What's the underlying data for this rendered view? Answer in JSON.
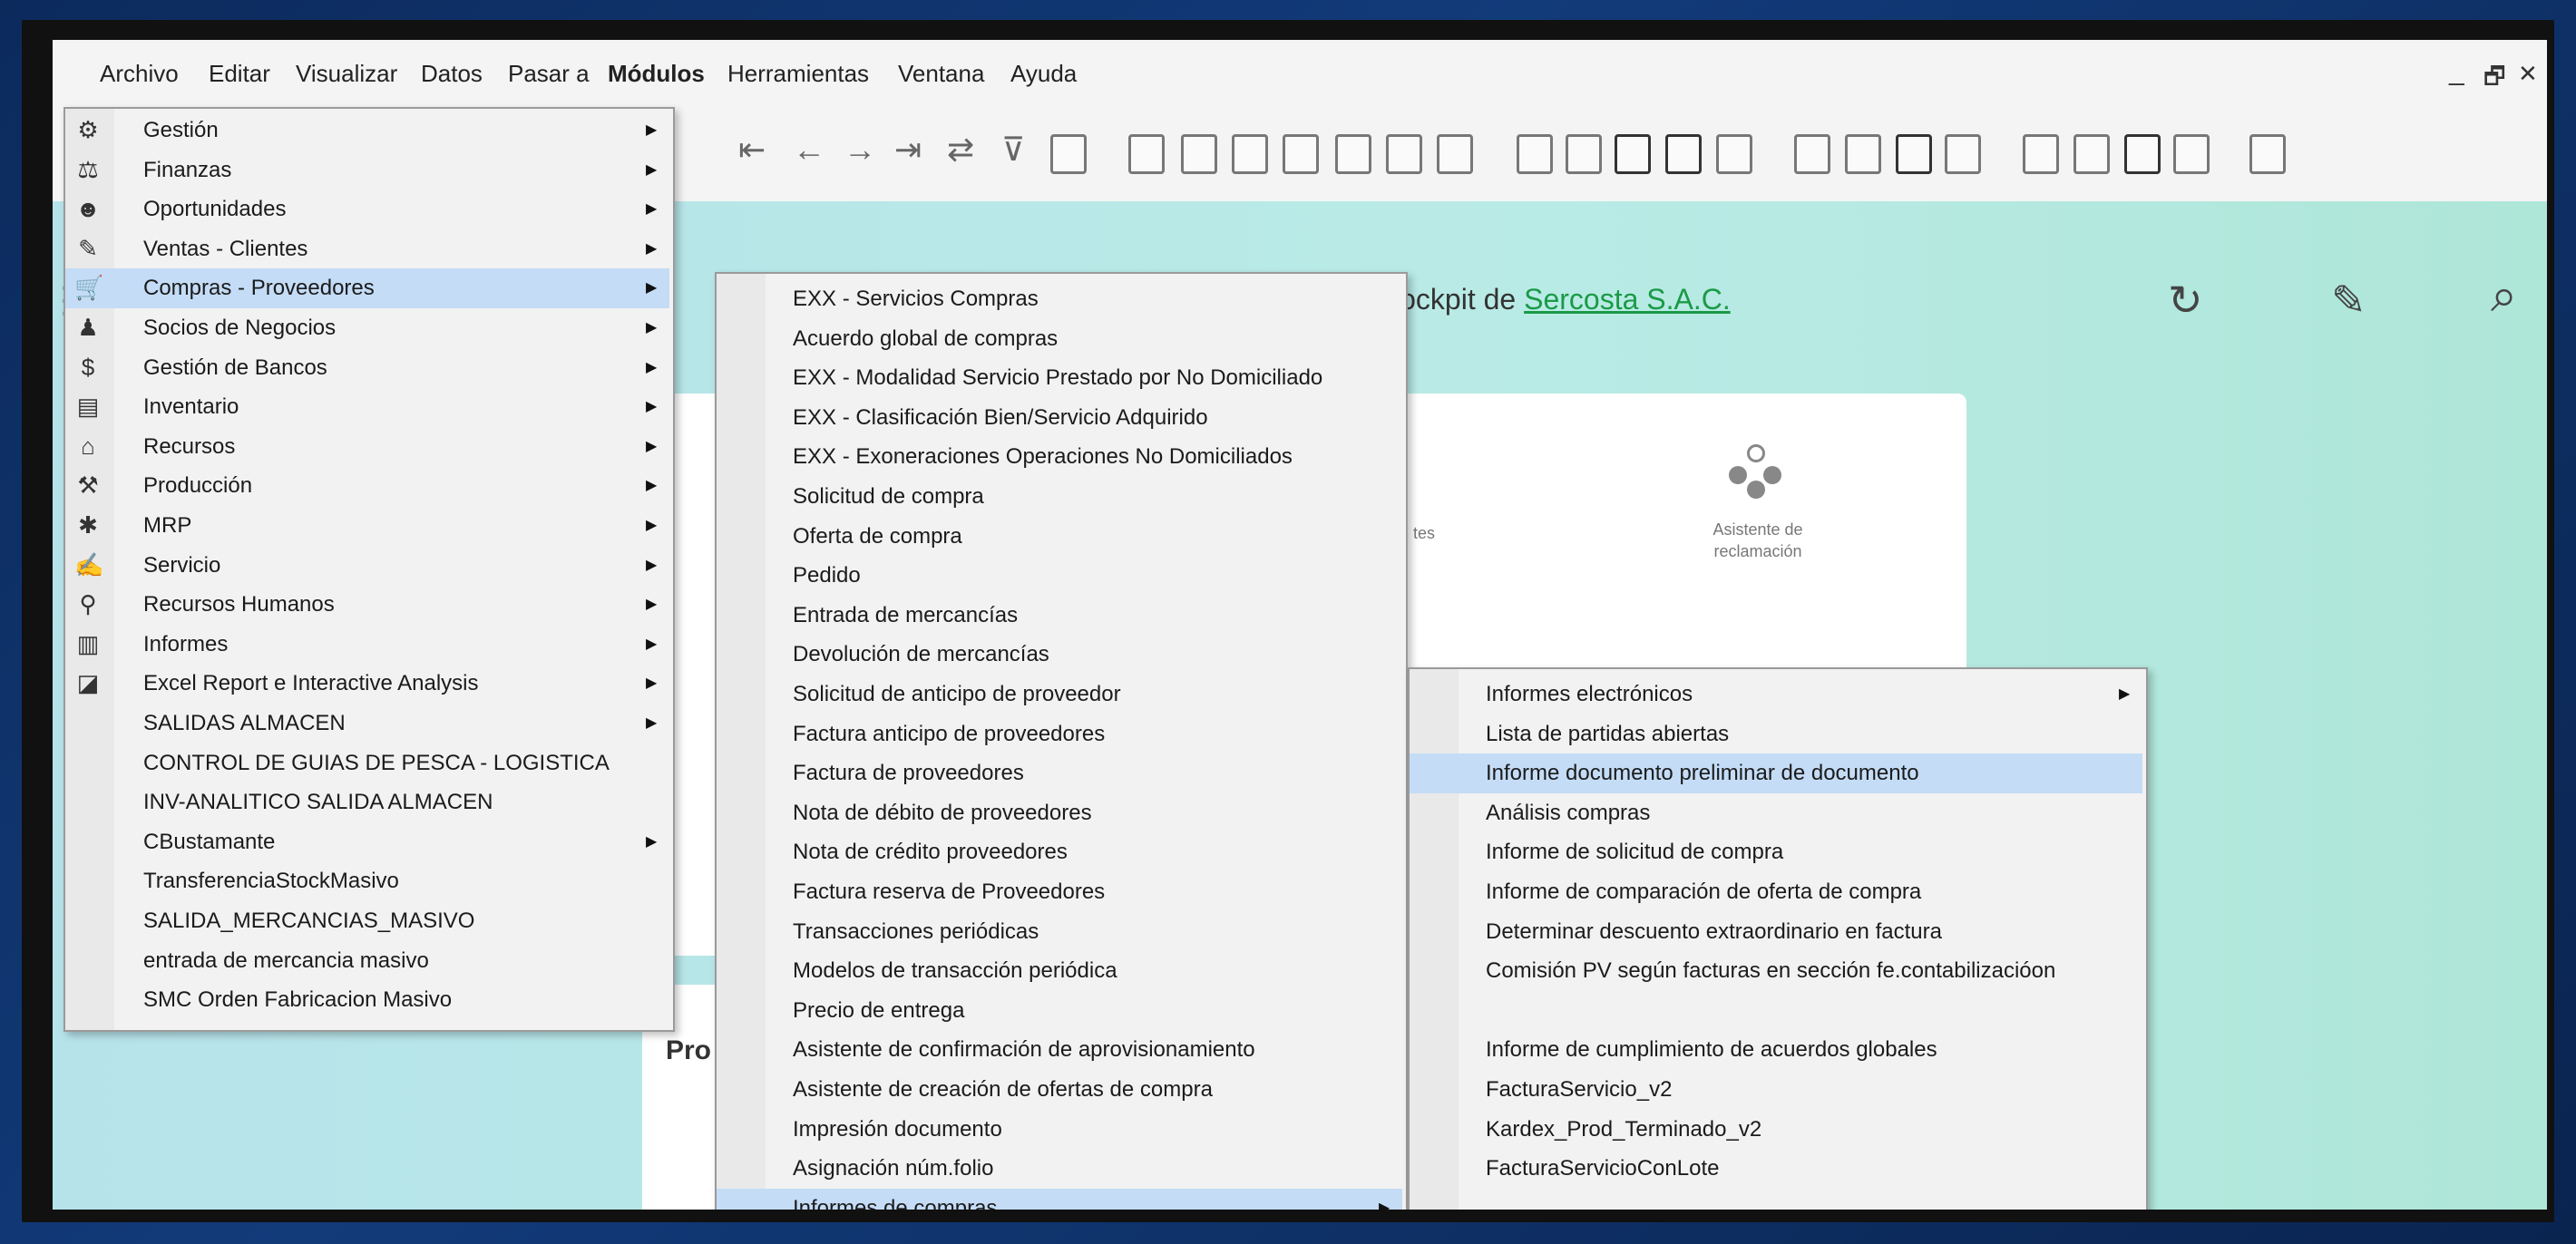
{
  "menubar": {
    "items": [
      "Archivo",
      "Editar",
      "Visualizar",
      "Datos",
      "Pasar a",
      "Módulos",
      "Herramientas",
      "Ventana",
      "Ayuda"
    ],
    "window_controls": [
      "_",
      "🗗",
      "✕"
    ]
  },
  "cockpit": {
    "welcome_prefix": "Bienvenido, manager. Se conectó a cockpit de ",
    "company": "Sercosta S.A.C.",
    "truncated_tes": "tes",
    "assistant_label": "Asistente de reclamación",
    "pro_label": "Pro",
    "refresh_icon": "↻",
    "edit_icon": "✎",
    "search_icon": "⌕",
    "hamburger_icon": "☰"
  },
  "modules_menu": {
    "items": [
      {
        "label": "Gestión",
        "icon": "⚙",
        "submenu": true
      },
      {
        "label": "Finanzas",
        "icon": "⚖",
        "submenu": true
      },
      {
        "label": "Oportunidades",
        "icon": "☻",
        "submenu": true
      },
      {
        "label": "Ventas - Clientes",
        "icon": "✎",
        "submenu": true
      },
      {
        "label": "Compras - Proveedores",
        "icon": "🛒",
        "submenu": true
      },
      {
        "label": "Socios de Negocios",
        "icon": "♟",
        "submenu": true
      },
      {
        "label": "Gestión de Bancos",
        "icon": "$",
        "submenu": true
      },
      {
        "label": "Inventario",
        "icon": "▤",
        "submenu": true
      },
      {
        "label": "Recursos",
        "icon": "⌂",
        "submenu": true
      },
      {
        "label": "Producción",
        "icon": "⚒",
        "submenu": true
      },
      {
        "label": "MRP",
        "icon": "✱",
        "submenu": true
      },
      {
        "label": "Servicio",
        "icon": "✍",
        "submenu": true
      },
      {
        "label": "Recursos Humanos",
        "icon": "⚲",
        "submenu": true
      },
      {
        "label": "Informes",
        "icon": "▥",
        "submenu": true
      },
      {
        "label": "Excel Report e Interactive Analysis",
        "icon": "◪",
        "submenu": true
      },
      {
        "label": "SALIDAS ALMACEN",
        "icon": "",
        "submenu": true
      },
      {
        "label": "CONTROL DE GUIAS DE PESCA  -  LOGISTICA",
        "icon": "",
        "submenu": false
      },
      {
        "label": "INV-ANALITICO SALIDA ALMACEN",
        "icon": "",
        "submenu": false
      },
      {
        "label": "CBustamante",
        "icon": "",
        "submenu": true
      },
      {
        "label": "TransferenciaStockMasivo",
        "icon": "",
        "submenu": false
      },
      {
        "label": "SALIDA_MERCANCIAS_MASIVO",
        "icon": "",
        "submenu": false
      },
      {
        "label": "entrada de mercancia masivo",
        "icon": "",
        "submenu": false
      },
      {
        "label": "SMC Orden Fabricacion Masivo",
        "icon": "",
        "submenu": false
      }
    ]
  },
  "compras_menu": {
    "items": [
      {
        "label": "EXX - Servicios Compras",
        "submenu": false
      },
      {
        "label": "Acuerdo global de compras",
        "submenu": false
      },
      {
        "label": "EXX - Modalidad Servicio Prestado por No Domiciliado",
        "submenu": false
      },
      {
        "label": "EXX - Clasificación Bien/Servicio Adquirido",
        "submenu": false
      },
      {
        "label": "EXX - Exoneraciones Operaciones No Domiciliados",
        "submenu": false
      },
      {
        "label": "Solicitud de compra",
        "submenu": false
      },
      {
        "label": "Oferta de compra",
        "submenu": false
      },
      {
        "label": "Pedido",
        "submenu": false
      },
      {
        "label": "Entrada de mercancías",
        "submenu": false
      },
      {
        "label": "Devolución de mercancías",
        "submenu": false
      },
      {
        "label": "Solicitud de anticipo de proveedor",
        "submenu": false
      },
      {
        "label": "Factura anticipo de proveedores",
        "submenu": false
      },
      {
        "label": "Factura de proveedores",
        "submenu": false
      },
      {
        "label": "Nota de débito de proveedores",
        "submenu": false
      },
      {
        "label": "Nota de crédito proveedores",
        "submenu": false
      },
      {
        "label": "Factura reserva de Proveedores",
        "submenu": false
      },
      {
        "label": "Transacciones periódicas",
        "submenu": false
      },
      {
        "label": "Modelos de transacción periódica",
        "submenu": false
      },
      {
        "label": "Precio de entrega",
        "submenu": false
      },
      {
        "label": "Asistente de confirmación de aprovisionamiento",
        "submenu": false
      },
      {
        "label": "Asistente de creación de ofertas de compra",
        "submenu": false
      },
      {
        "label": "Impresión documento",
        "submenu": false
      },
      {
        "label": "Asignación núm.folio",
        "submenu": false
      },
      {
        "label": "Informes de compras",
        "submenu": true
      }
    ]
  },
  "informes_menu": {
    "items": [
      {
        "label": "Informes electrónicos",
        "submenu": true
      },
      {
        "label": "Lista de partidas abiertas",
        "submenu": false
      },
      {
        "label": "Informe documento preliminar de documento",
        "submenu": false
      },
      {
        "label": "Análisis compras",
        "submenu": false
      },
      {
        "label": "Informe de solicitud de compra",
        "submenu": false
      },
      {
        "label": "Informe de comparación de oferta de compra",
        "submenu": false
      },
      {
        "label": "Determinar descuento extraordinario en factura",
        "submenu": false
      },
      {
        "label": "Comisión PV según facturas en sección fe.contabilizacióon",
        "submenu": false
      },
      {
        "label": "",
        "submenu": false
      },
      {
        "label": "Informe de cumplimiento de acuerdos globales",
        "submenu": false
      },
      {
        "label": "FacturaServicio_v2",
        "submenu": false
      },
      {
        "label": "Kardex_Prod_Terminado_v2",
        "submenu": false
      },
      {
        "label": "FacturaServicioConLote",
        "submenu": false
      }
    ]
  }
}
